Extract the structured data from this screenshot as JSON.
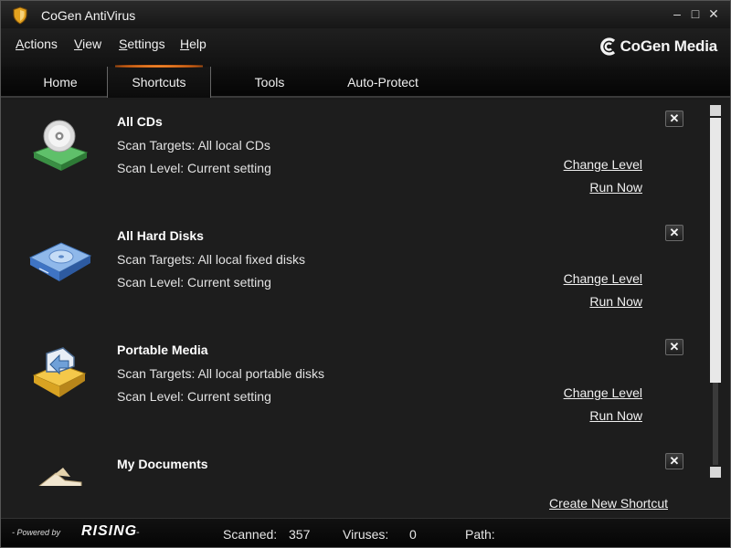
{
  "window": {
    "title": "CoGen AntiVirus",
    "minimize": "–",
    "maximize": "□",
    "close": "✕",
    "accent_color": "#e07a1f"
  },
  "menu": {
    "items": [
      {
        "first": "A",
        "rest": "ctions"
      },
      {
        "first": "V",
        "rest": "iew"
      },
      {
        "first": "S",
        "rest": "ettings"
      },
      {
        "first": "H",
        "rest": "elp"
      }
    ],
    "brand": "CoGen Media"
  },
  "tabs": [
    {
      "label": "Home",
      "active": false
    },
    {
      "label": "Shortcuts",
      "active": true
    },
    {
      "label": "Tools",
      "active": false
    },
    {
      "label": "Auto-Protect",
      "active": false
    }
  ],
  "shortcuts": [
    {
      "title": "All CDs",
      "icon": "cd-drive-icon",
      "targets": "Scan Targets: All local CDs",
      "level": "Scan Level: Current setting",
      "change": "Change Level",
      "run": "Run Now",
      "close": "✕"
    },
    {
      "title": "All Hard Disks",
      "icon": "hard-disk-icon",
      "targets": "Scan Targets: All local fixed disks",
      "level": "Scan Level: Current setting",
      "change": "Change Level",
      "run": "Run Now",
      "close": "✕"
    },
    {
      "title": "Portable Media",
      "icon": "portable-media-icon",
      "targets": "Scan Targets: All local portable disks",
      "level": "Scan Level: Current setting",
      "change": "Change Level",
      "run": "Run Now",
      "close": "✕"
    },
    {
      "title": "My Documents",
      "icon": "documents-icon",
      "close": "✕"
    }
  ],
  "create_shortcut": "Create New Shortcut",
  "status": {
    "powered_by": "- Powered by",
    "logo": "RISING",
    "logo_dash": "-",
    "scanned_label": "Scanned:",
    "scanned_value": "357",
    "viruses_label": "Viruses:",
    "viruses_value": "0",
    "path_label": "Path:"
  }
}
